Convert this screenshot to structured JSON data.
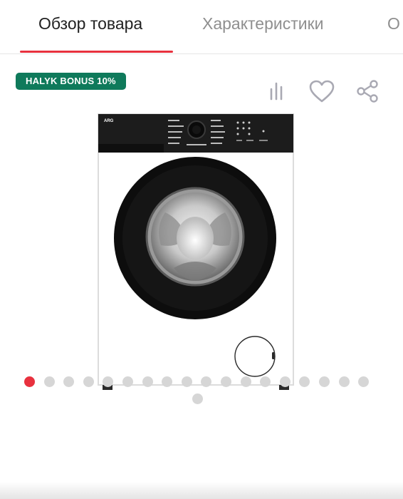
{
  "tabs": [
    {
      "label": "Обзор товара",
      "active": true
    },
    {
      "label": "Характеристики",
      "active": false
    },
    {
      "label": "О",
      "active": false
    }
  ],
  "badge": {
    "label": "HALYK BONUS 10%",
    "color": "#0f7a5b"
  },
  "actions": {
    "compare_icon": "bar-chart-icon",
    "favorite_icon": "heart-icon",
    "share_icon": "share-icon"
  },
  "product": {
    "brand": "ARG",
    "image_description_icon": "washing-machine"
  },
  "carousel": {
    "total_images": 19,
    "active_index": 1,
    "accent_color": "#e8313e"
  },
  "colors": {
    "accent": "#e8313e",
    "inactive_tab": "#8f8f8f",
    "icon": "#a9a9b3"
  }
}
